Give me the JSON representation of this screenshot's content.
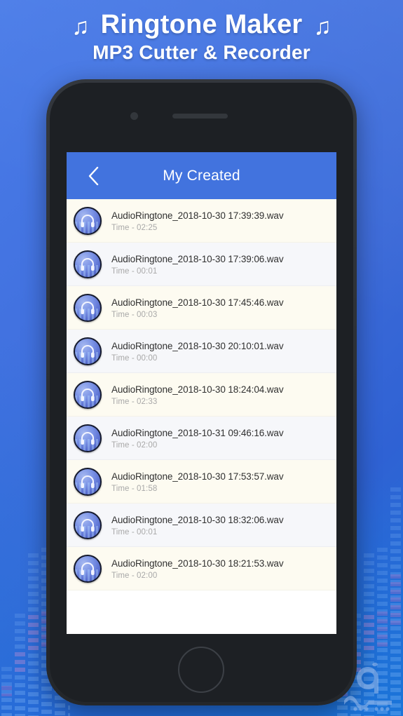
{
  "headline": {
    "note_icon_left": "♫",
    "note_icon_right": "♫",
    "title": "Ringtone Maker",
    "subtitle": "MP3 Cutter & Recorder"
  },
  "phone": {
    "camera": "camera-dot",
    "speaker": "earpiece-speaker",
    "home": "home-button"
  },
  "appbar": {
    "back_icon": "back-chevron-icon",
    "title": "My Created",
    "background_color": "#4273de"
  },
  "list": {
    "time_prefix": "Time - ",
    "items": [
      {
        "name": "AudioRingtone_2018-10-30 17:39:39.wav",
        "time": "Time - 02:25"
      },
      {
        "name": "AudioRingtone_2018-10-30 17:39:06.wav",
        "time": "Time - 00:01"
      },
      {
        "name": "AudioRingtone_2018-10-30 17:45:46.wav",
        "time": "Time - 00:03"
      },
      {
        "name": "AudioRingtone_2018-10-30 20:10:01.wav",
        "time": "Time - 00:00"
      },
      {
        "name": "AudioRingtone_2018-10-30 18:24:04.wav",
        "time": "Time - 02:33"
      },
      {
        "name": "AudioRingtone_2018-10-31 09:46:16.wav",
        "time": "Time - 02:00"
      },
      {
        "name": "AudioRingtone_2018-10-30 17:53:57.wav",
        "time": "Time - 01:58"
      },
      {
        "name": "AudioRingtone_2018-10-30 18:32:06.wav",
        "time": "Time - 00:01"
      },
      {
        "name": "AudioRingtone_2018-10-30 18:21:53.wav",
        "time": "Time - 02:00"
      }
    ]
  },
  "watermark": {
    "label": "سیب اپ"
  },
  "colors": {
    "brand_blue": "#4273de",
    "background_blue": "#3f72de",
    "row_cream": "#fdfbf1",
    "row_gray": "#f6f7fa",
    "filename_text": "#303030",
    "time_text": "#a8a8a8"
  }
}
